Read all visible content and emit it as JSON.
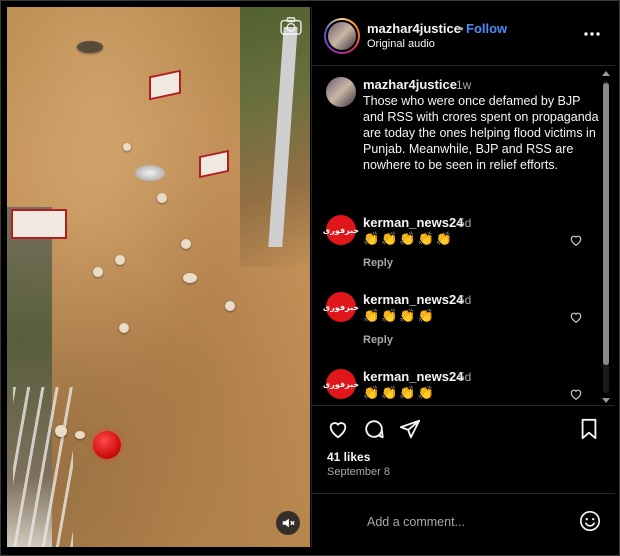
{
  "post": {
    "username": "mazhar4justice",
    "separator": "•",
    "follow_label": "Follow",
    "audio": "Original audio"
  },
  "caption": {
    "username": "mazhar4justice",
    "time": "1w",
    "text": "Those who were once defamed by BJP and RSS with crores spent on propaganda are today the ones helping flood victims in Punjab. Meanwhile, BJP and RSS are nowhere to be seen in relief efforts."
  },
  "comments": [
    {
      "username": "kerman_news24",
      "time": "5d",
      "text": "👏👏👏👏👏",
      "reply_label": "Reply",
      "avatar_text": "خبرفوری"
    },
    {
      "username": "kerman_news24",
      "time": "5d",
      "text": "👏👏👏👏",
      "reply_label": "Reply",
      "avatar_text": "خبرفوری"
    },
    {
      "username": "kerman_news24",
      "time": "5d",
      "text": "👏👏👏👏",
      "avatar_text": "خبرفوری"
    }
  ],
  "engagement": {
    "likes": "41 likes",
    "date": "September 8"
  },
  "composer": {
    "placeholder": "Add a comment..."
  },
  "icons": {
    "more": "more-options-icon",
    "like": "heart-icon",
    "comment": "comment-icon",
    "share": "share-icon",
    "save": "bookmark-icon",
    "emoji": "emoji-icon",
    "mute": "muted-speaker-icon",
    "camera": "camera-icon"
  },
  "colors": {
    "follow": "#4c8cf5",
    "comment_avatar": "#e0161b",
    "background": "#000000"
  }
}
